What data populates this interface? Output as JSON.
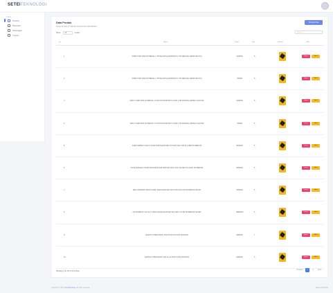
{
  "brand": {
    "part1": "SETEI",
    "part2": "TEKNOLOGI"
  },
  "sidebar": {
    "heading": "menu",
    "items": [
      {
        "label": "Produk"
      },
      {
        "label": "Pesanan"
      },
      {
        "label": "Pelanggan"
      },
      {
        "label": "Logout"
      }
    ]
  },
  "card": {
    "title": "Data Produk",
    "subtitle": "Daftar Produk PT SETEI TEKNOLOGI INDONESIA",
    "add_label": "Tambah Data",
    "show_label": "Show",
    "show_value": "10",
    "entries_label": "entries",
    "search_placeholder": "Search"
  },
  "table": {
    "headers": [
      "No",
      "Nama",
      "Harga",
      "Stok",
      "Gambar",
      "Aksi"
    ],
    "delete_label": "Hapus",
    "edit_label": "Ubah",
    "rows": [
      {
        "no": "1",
        "name": "[OPR] HARD DISK EXTERNAL 2 TB SEAGATE EXPANSION 2 TB ORIGINAL RESMI (BLACK)",
        "price": "1425000",
        "stock": "5"
      },
      {
        "no": "2",
        "name": "[OPR] HARD DISK EXTERNAL 2 TB SEAGATE EXPANSION 1 TB ORIGINAL RESMI (BLACK)",
        "price": "780000",
        "stock": "5"
      },
      {
        "no": "3",
        "name": "WPUC HARD DISK EXTERNAL 2.5 HD WP PASSPORT ULTRA 1 TB ORIGINAL RESMI (COLOUR)",
        "price": "1299000",
        "stock": "5"
      },
      {
        "no": "4",
        "name": "WPUC HARD DISK EXTERNAL 2.5 HD WP PASSPORT ULTRA 2 TB ORIGINAL RESMI (COLOUR)",
        "price": "795000",
        "stock": "5"
      },
      {
        "no": "5",
        "name": "ACER ASPIRE 3 A315 I3 1215U 8GB 512GB SSD 15.6 FHD W11 OHS ALL NEW NOTEBOOK",
        "price": "6500000",
        "stock": "5"
      },
      {
        "no": "6",
        "name": "ASUS E1504GA I3 N305 FHD 8GB 512GB SSD W11 OHS COOL SILVER 15.6 INCH NOTEBOOK",
        "price": "8250000",
        "stock": "5"
      },
      {
        "no": "7",
        "name": "DELL INSPIRON 3520 I5 1235U 8GB 512GB SSD W11 OHS 15.6 FHD NOTEBOOK BLACK",
        "price": "9250000",
        "stock": "5"
      },
      {
        "no": "8",
        "name": "HP PROBOOK 440 G9 I7 1255U 16GB 512GB SSD W11 PRO 14 FHD NOTEBOOK SILVER",
        "price": "18500000",
        "stock": "5"
      },
      {
        "no": "9",
        "name": "LENOVO THINKVISION T24I-30 23.8 IPS FHD MONITOR",
        "price": "2850000",
        "stock": "7"
      },
      {
        "no": "10",
        "name": "LENOVO THINKVISION T22I-30 21.5 INCH FHD MONITOR",
        "price": "2650000",
        "stock": "5"
      }
    ]
  },
  "footer": {
    "info": "Showing 1 to 10 of 12 entries",
    "prev": "Previous",
    "pages": [
      "1",
      "2"
    ],
    "next": "Next",
    "copyright_prefix": "Copyright © 2024",
    "copyright_link": "SeteiTeknologi",
    "copyright_suffix": ". All rights reserved.",
    "made": "Made with Mazer"
  }
}
